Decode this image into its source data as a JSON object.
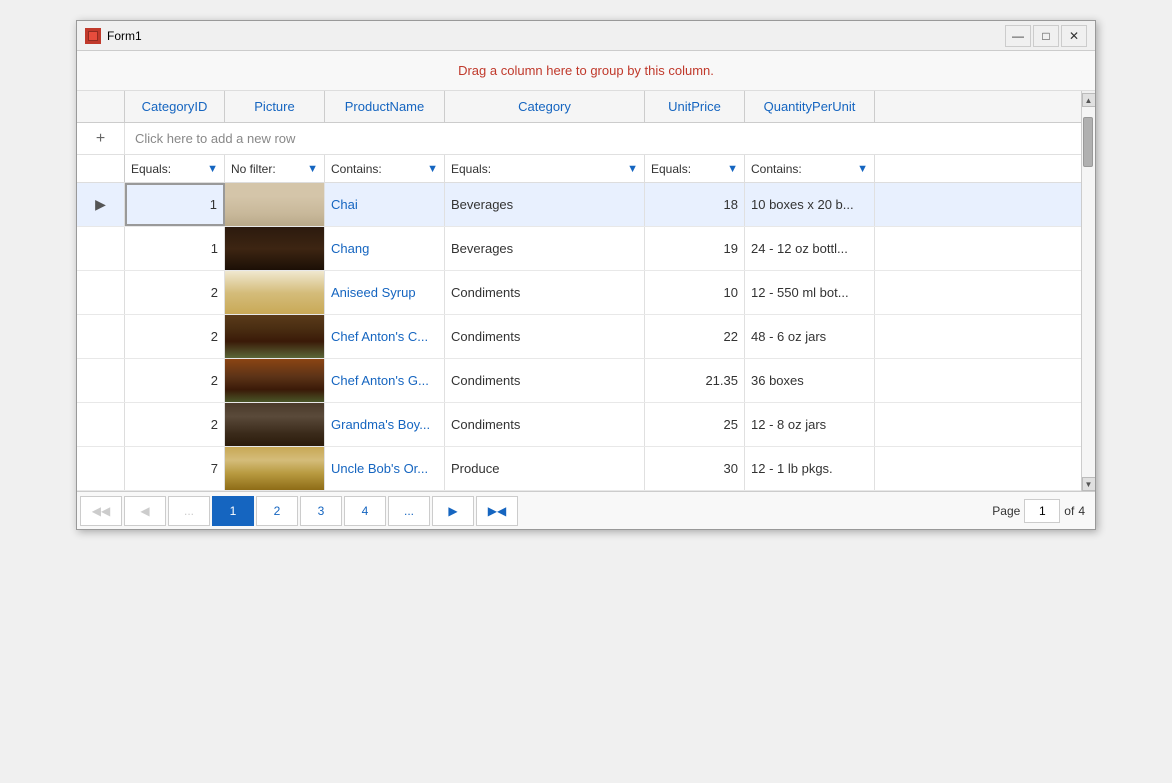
{
  "window": {
    "title": "Form1",
    "icon": "form-icon"
  },
  "titlebar": {
    "minimize_label": "—",
    "maximize_label": "□",
    "close_label": "✕"
  },
  "group_header": {
    "text": "Drag a column here to group by this column."
  },
  "columns": [
    {
      "id": "categoryid",
      "label": "CategoryID",
      "class": "col-categoryid"
    },
    {
      "id": "picture",
      "label": "Picture",
      "class": "col-picture"
    },
    {
      "id": "productname",
      "label": "ProductName",
      "class": "col-productname"
    },
    {
      "id": "category",
      "label": "Category",
      "class": "col-category"
    },
    {
      "id": "unitprice",
      "label": "UnitPrice",
      "class": "col-unitprice"
    },
    {
      "id": "quantityperunit",
      "label": "QuantityPerUnit",
      "class": "col-quantityperunit"
    }
  ],
  "add_row": {
    "text": "Click here to add a new row"
  },
  "filters": [
    {
      "label": "Equals:",
      "class": "col-categoryid"
    },
    {
      "label": "No filter:",
      "class": "col-picture"
    },
    {
      "label": "Contains:",
      "class": "col-productname"
    },
    {
      "label": "Equals:",
      "class": "col-category"
    },
    {
      "label": "Equals:",
      "class": "col-unitprice"
    },
    {
      "label": "Contains:",
      "class": "col-quantityperunit"
    }
  ],
  "rows": [
    {
      "indicator": "▶",
      "selected": true,
      "categoryid": "1",
      "picture_class": "pic-chai",
      "productname": "Chai",
      "category": "Beverages",
      "unitprice": "18",
      "quantityperunit": "10 boxes x 20 b..."
    },
    {
      "indicator": "",
      "selected": false,
      "categoryid": "1",
      "picture_class": "pic-chang",
      "productname": "Chang",
      "category": "Beverages",
      "unitprice": "19",
      "quantityperunit": "24 - 12 oz bottl..."
    },
    {
      "indicator": "",
      "selected": false,
      "categoryid": "2",
      "picture_class": "pic-aniseed",
      "productname": "Aniseed Syrup",
      "category": "Condiments",
      "unitprice": "10",
      "quantityperunit": "12 - 550 ml bot..."
    },
    {
      "indicator": "",
      "selected": false,
      "categoryid": "2",
      "picture_class": "pic-chefanton-c",
      "productname": "Chef Anton's C...",
      "category": "Condiments",
      "unitprice": "22",
      "quantityperunit": "48 - 6 oz jars"
    },
    {
      "indicator": "",
      "selected": false,
      "categoryid": "2",
      "picture_class": "pic-chefanton-g",
      "productname": "Chef Anton's G...",
      "category": "Condiments",
      "unitprice": "21.35",
      "quantityperunit": "36 boxes"
    },
    {
      "indicator": "",
      "selected": false,
      "categoryid": "2",
      "picture_class": "pic-grandma",
      "productname": "Grandma's Boy...",
      "category": "Condiments",
      "unitprice": "25",
      "quantityperunit": "12 - 8 oz jars"
    },
    {
      "indicator": "",
      "selected": false,
      "categoryid": "7",
      "picture_class": "pic-uncle",
      "productname": "Uncle Bob's Or...",
      "category": "Produce",
      "unitprice": "30",
      "quantityperunit": "12 - 1 lb pkgs."
    }
  ],
  "pagination": {
    "pages": [
      "1",
      "2",
      "3",
      "4",
      "..."
    ],
    "active_page": "1",
    "current_page_value": "1",
    "total_pages": "4",
    "page_label": "Page",
    "of_label": "of",
    "first_btn": "◀◀",
    "prev_btn": "◀",
    "next_btn": "▶",
    "last_btn": "▶◀",
    "ellipsis": "..."
  }
}
